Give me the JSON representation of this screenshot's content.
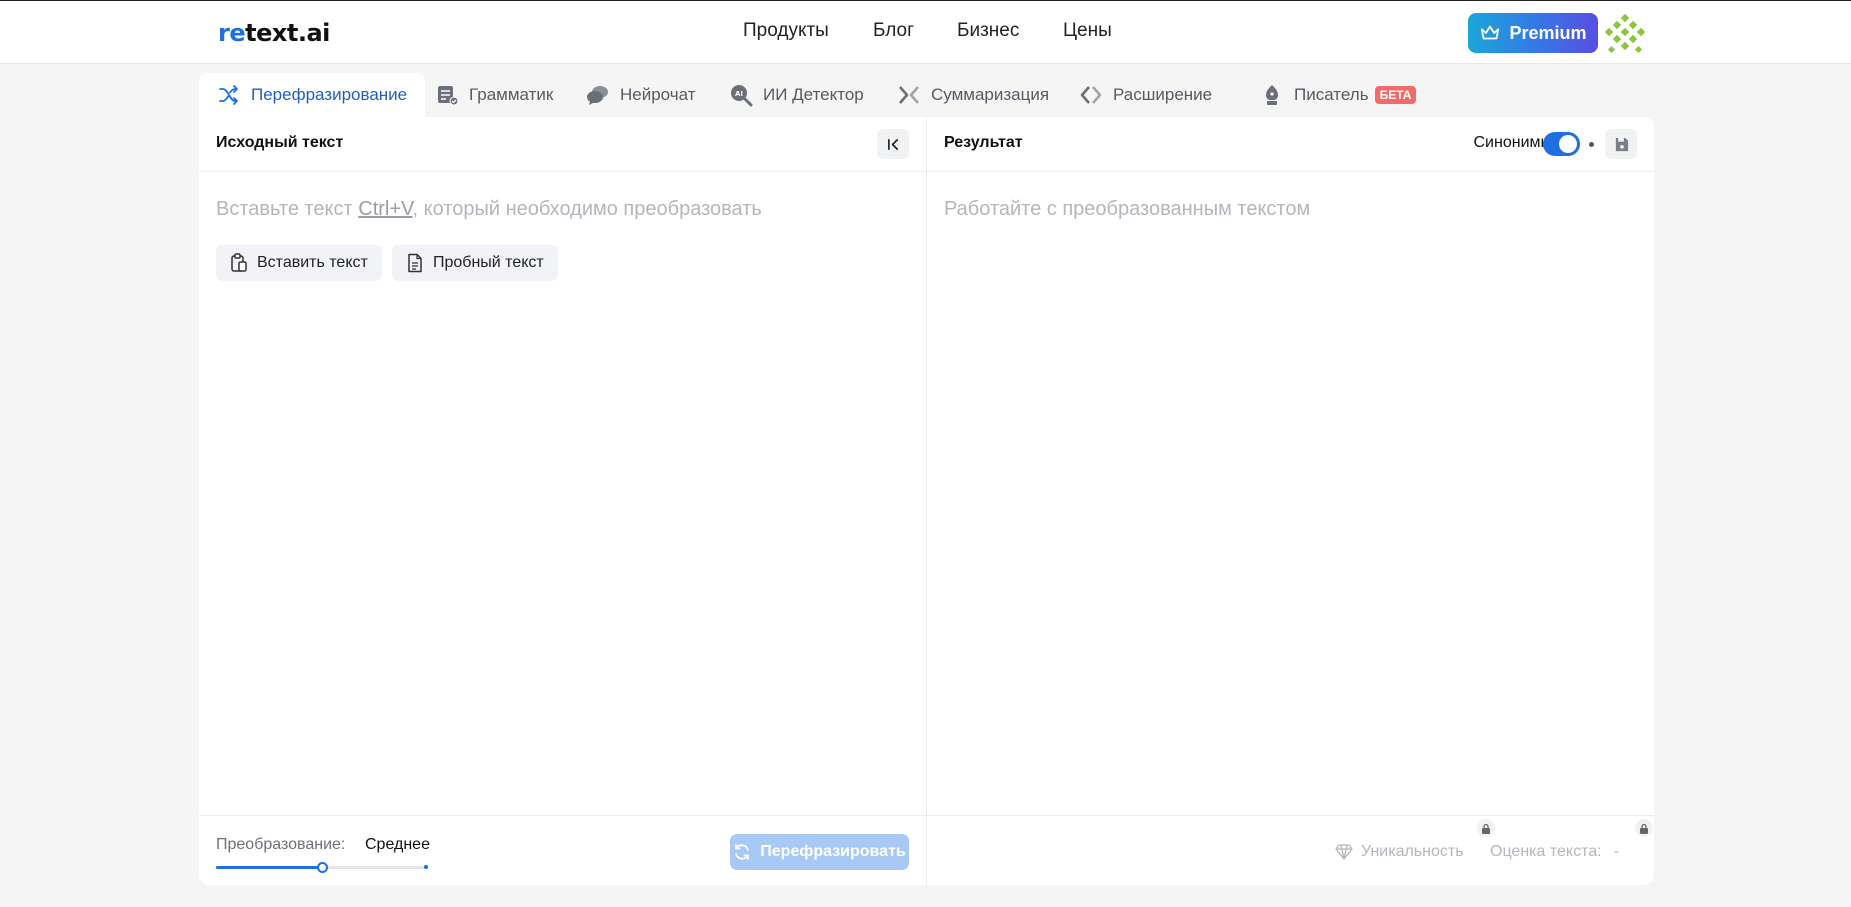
{
  "header": {
    "logo_re": "re",
    "logo_rest": "text.ai",
    "nav": [
      "Продукты",
      "Блог",
      "Бизнес",
      "Цены"
    ],
    "premium_label": "Premium"
  },
  "tabs": [
    {
      "label": "Перефразирование",
      "icon": "shuffle-icon",
      "active": true
    },
    {
      "label": "Грамматик",
      "icon": "grammar-icon"
    },
    {
      "label": "Нейрочат",
      "icon": "chat-bubbles-icon"
    },
    {
      "label": "ИИ Детектор",
      "icon": "ai-search-icon"
    },
    {
      "label": "Суммаризация",
      "icon": "collapse-arrows-icon"
    },
    {
      "label": "Расширение",
      "icon": "expand-arrows-icon"
    },
    {
      "label": "Писатель",
      "icon": "pen-nib-icon",
      "badge": "БЕТА"
    }
  ],
  "source": {
    "title": "Исходный текст",
    "collapse_icon": "collapse-left-icon",
    "placeholder_before": "Вставьте текст ",
    "placeholder_shortcut": "Ctrl+V",
    "placeholder_after": ", который необходимо преобразовать",
    "paste_label": "Вставить текст",
    "sample_label": "Пробный текст",
    "mode_label": "Преобразование:",
    "mode_value": "Среднее",
    "mode_level": 0.5,
    "rephrase_label": "Перефразировать"
  },
  "result": {
    "title": "Результат",
    "synonyms_label": "Синонимы",
    "synonyms_on": true,
    "placeholder": "Работайте с преобразованным текстом",
    "uniqueness_label": "Уникальность",
    "score_label": "Оценка текста:",
    "score_value": "-"
  },
  "colors": {
    "accent": "#1f6fe0",
    "beta_badge": "#f26a6a"
  }
}
